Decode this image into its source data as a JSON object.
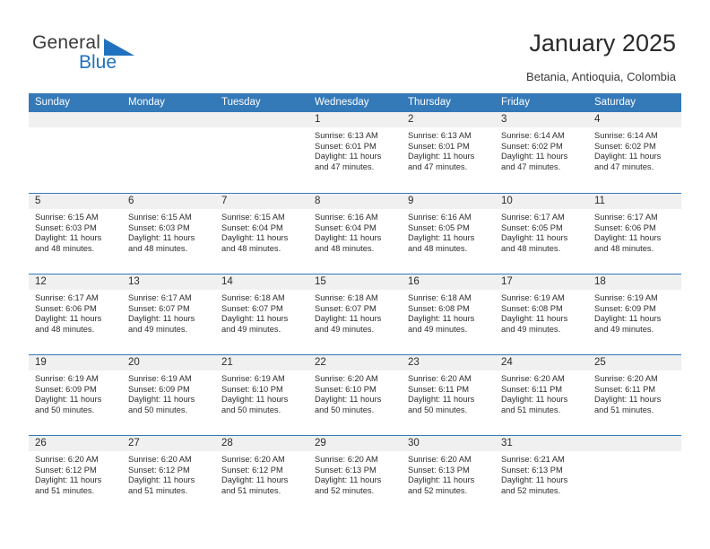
{
  "brand": {
    "name_part1": "General",
    "name_part2": "Blue",
    "accent_color": "#1f72bd"
  },
  "header": {
    "title": "January 2025",
    "subtitle": "Betania, Antioquia, Colombia"
  },
  "calendar": {
    "header_background": "#3479b8",
    "daynum_background": "#f0f0f0",
    "weekdays": [
      "Sunday",
      "Monday",
      "Tuesday",
      "Wednesday",
      "Thursday",
      "Friday",
      "Saturday"
    ],
    "weeks": [
      [
        {
          "day": "",
          "lines": [
            "",
            "",
            "",
            ""
          ]
        },
        {
          "day": "",
          "lines": [
            "",
            "",
            "",
            ""
          ]
        },
        {
          "day": "",
          "lines": [
            "",
            "",
            "",
            ""
          ]
        },
        {
          "day": "1",
          "lines": [
            "Sunrise: 6:13 AM",
            "Sunset: 6:01 PM",
            "Daylight: 11 hours",
            "and 47 minutes."
          ]
        },
        {
          "day": "2",
          "lines": [
            "Sunrise: 6:13 AM",
            "Sunset: 6:01 PM",
            "Daylight: 11 hours",
            "and 47 minutes."
          ]
        },
        {
          "day": "3",
          "lines": [
            "Sunrise: 6:14 AM",
            "Sunset: 6:02 PM",
            "Daylight: 11 hours",
            "and 47 minutes."
          ]
        },
        {
          "day": "4",
          "lines": [
            "Sunrise: 6:14 AM",
            "Sunset: 6:02 PM",
            "Daylight: 11 hours",
            "and 47 minutes."
          ]
        }
      ],
      [
        {
          "day": "5",
          "lines": [
            "Sunrise: 6:15 AM",
            "Sunset: 6:03 PM",
            "Daylight: 11 hours",
            "and 48 minutes."
          ]
        },
        {
          "day": "6",
          "lines": [
            "Sunrise: 6:15 AM",
            "Sunset: 6:03 PM",
            "Daylight: 11 hours",
            "and 48 minutes."
          ]
        },
        {
          "day": "7",
          "lines": [
            "Sunrise: 6:15 AM",
            "Sunset: 6:04 PM",
            "Daylight: 11 hours",
            "and 48 minutes."
          ]
        },
        {
          "day": "8",
          "lines": [
            "Sunrise: 6:16 AM",
            "Sunset: 6:04 PM",
            "Daylight: 11 hours",
            "and 48 minutes."
          ]
        },
        {
          "day": "9",
          "lines": [
            "Sunrise: 6:16 AM",
            "Sunset: 6:05 PM",
            "Daylight: 11 hours",
            "and 48 minutes."
          ]
        },
        {
          "day": "10",
          "lines": [
            "Sunrise: 6:17 AM",
            "Sunset: 6:05 PM",
            "Daylight: 11 hours",
            "and 48 minutes."
          ]
        },
        {
          "day": "11",
          "lines": [
            "Sunrise: 6:17 AM",
            "Sunset: 6:06 PM",
            "Daylight: 11 hours",
            "and 48 minutes."
          ]
        }
      ],
      [
        {
          "day": "12",
          "lines": [
            "Sunrise: 6:17 AM",
            "Sunset: 6:06 PM",
            "Daylight: 11 hours",
            "and 48 minutes."
          ]
        },
        {
          "day": "13",
          "lines": [
            "Sunrise: 6:17 AM",
            "Sunset: 6:07 PM",
            "Daylight: 11 hours",
            "and 49 minutes."
          ]
        },
        {
          "day": "14",
          "lines": [
            "Sunrise: 6:18 AM",
            "Sunset: 6:07 PM",
            "Daylight: 11 hours",
            "and 49 minutes."
          ]
        },
        {
          "day": "15",
          "lines": [
            "Sunrise: 6:18 AM",
            "Sunset: 6:07 PM",
            "Daylight: 11 hours",
            "and 49 minutes."
          ]
        },
        {
          "day": "16",
          "lines": [
            "Sunrise: 6:18 AM",
            "Sunset: 6:08 PM",
            "Daylight: 11 hours",
            "and 49 minutes."
          ]
        },
        {
          "day": "17",
          "lines": [
            "Sunrise: 6:19 AM",
            "Sunset: 6:08 PM",
            "Daylight: 11 hours",
            "and 49 minutes."
          ]
        },
        {
          "day": "18",
          "lines": [
            "Sunrise: 6:19 AM",
            "Sunset: 6:09 PM",
            "Daylight: 11 hours",
            "and 49 minutes."
          ]
        }
      ],
      [
        {
          "day": "19",
          "lines": [
            "Sunrise: 6:19 AM",
            "Sunset: 6:09 PM",
            "Daylight: 11 hours",
            "and 50 minutes."
          ]
        },
        {
          "day": "20",
          "lines": [
            "Sunrise: 6:19 AM",
            "Sunset: 6:09 PM",
            "Daylight: 11 hours",
            "and 50 minutes."
          ]
        },
        {
          "day": "21",
          "lines": [
            "Sunrise: 6:19 AM",
            "Sunset: 6:10 PM",
            "Daylight: 11 hours",
            "and 50 minutes."
          ]
        },
        {
          "day": "22",
          "lines": [
            "Sunrise: 6:20 AM",
            "Sunset: 6:10 PM",
            "Daylight: 11 hours",
            "and 50 minutes."
          ]
        },
        {
          "day": "23",
          "lines": [
            "Sunrise: 6:20 AM",
            "Sunset: 6:11 PM",
            "Daylight: 11 hours",
            "and 50 minutes."
          ]
        },
        {
          "day": "24",
          "lines": [
            "Sunrise: 6:20 AM",
            "Sunset: 6:11 PM",
            "Daylight: 11 hours",
            "and 51 minutes."
          ]
        },
        {
          "day": "25",
          "lines": [
            "Sunrise: 6:20 AM",
            "Sunset: 6:11 PM",
            "Daylight: 11 hours",
            "and 51 minutes."
          ]
        }
      ],
      [
        {
          "day": "26",
          "lines": [
            "Sunrise: 6:20 AM",
            "Sunset: 6:12 PM",
            "Daylight: 11 hours",
            "and 51 minutes."
          ]
        },
        {
          "day": "27",
          "lines": [
            "Sunrise: 6:20 AM",
            "Sunset: 6:12 PM",
            "Daylight: 11 hours",
            "and 51 minutes."
          ]
        },
        {
          "day": "28",
          "lines": [
            "Sunrise: 6:20 AM",
            "Sunset: 6:12 PM",
            "Daylight: 11 hours",
            "and 51 minutes."
          ]
        },
        {
          "day": "29",
          "lines": [
            "Sunrise: 6:20 AM",
            "Sunset: 6:13 PM",
            "Daylight: 11 hours",
            "and 52 minutes."
          ]
        },
        {
          "day": "30",
          "lines": [
            "Sunrise: 6:20 AM",
            "Sunset: 6:13 PM",
            "Daylight: 11 hours",
            "and 52 minutes."
          ]
        },
        {
          "day": "31",
          "lines": [
            "Sunrise: 6:21 AM",
            "Sunset: 6:13 PM",
            "Daylight: 11 hours",
            "and 52 minutes."
          ]
        },
        {
          "day": "",
          "lines": [
            "",
            "",
            "",
            ""
          ]
        }
      ]
    ]
  }
}
